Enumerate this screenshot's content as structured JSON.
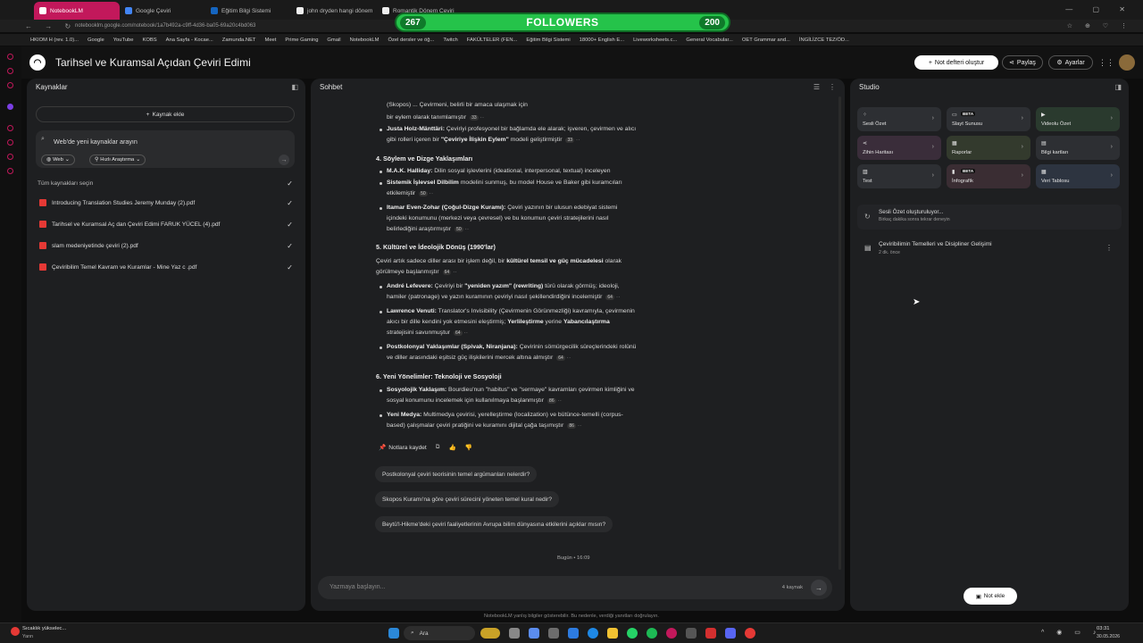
{
  "browser": {
    "tabs": [
      {
        "label": "NotebookLM",
        "active": true
      },
      {
        "label": "Google Çeviri",
        "active": false
      },
      {
        "label": "Eğitim Bilgi Sistemi",
        "active": false
      },
      {
        "label": "john dryden hangi dönem",
        "active": false
      },
      {
        "label": "Romantik Dönem Çeviri",
        "active": false
      }
    ],
    "url": "notebooklm.google.com/notebook/1a7b492a-c9ff-4d36-ba05-69a20c4bd063",
    "bookmarks": [
      "HKIOM H (rev. 1.0)...",
      "Google",
      "YouTube",
      "KOBS",
      "Ana Sayfa - Kocae...",
      "Zamunda.NET",
      "Meet",
      "Prime Gaming",
      "Gmail",
      "NotebookLM",
      "Özel dersler ve öğ...",
      "Twitch",
      "FAKÜLTELER (FEN...",
      "Eğitim Bilgi Sistemi",
      "18000+ English E...",
      "Liveworksheets.c...",
      "General Vocabular...",
      "OET Grammar and...",
      "İNGİLİZCE TEZ/ÖD..."
    ]
  },
  "overlay": {
    "left_count": "267",
    "label": "FOLLOWERS",
    "right_count": "200"
  },
  "header": {
    "title": "Tarihsel ve Kuramsal Açıdan Çeviri Edimi",
    "new_notebook": "Not defteri oluştur",
    "share": "Paylaş",
    "settings": "Ayarlar"
  },
  "sources": {
    "title": "Kaynaklar",
    "add_source": "Kaynak ekle",
    "search_placeholder": "Web'de yeni kaynaklar arayın",
    "web_chip": "Web",
    "research_chip": "Hızlı Araştırma",
    "select_all": "Tüm kaynakları seçin",
    "items": [
      "Introducing Translation Studies Jeremy Munday (2).pdf",
      "Tarihsel ve Kuramsal Aç dan Çeviri Edimi FARUK YÜCEL (4).pdf",
      "slam medeniyetinde çeviri (2).pdf",
      "Çeviribilim Temel Kavram ve Kuramlar - Mine Yaz c .pdf"
    ]
  },
  "chat": {
    "title": "Sohbet",
    "lines": [
      {
        "t": "(Skopos) ... Çevirmeni, belirli bir amaca ulaşmak için",
        "bold": false
      },
      {
        "t": "bir eylem olarak tanımlamıştır",
        "cite": "33"
      },
      {
        "b": "Justa Holz-Mänttäri:",
        "t": " Çeviriyi profesyonel bir bağlamda ele alarak; işveren, çevirmen ve alıcı"
      },
      {
        "t": "gibi rolleri içeren bir ",
        "b2": "\"Çeviriye İlişkin Eylem\"",
        "t2": " modeli geliştirmiştir",
        "cite": "33"
      },
      {
        "h": "4. Söylem ve Dizge Yaklaşımları"
      },
      {
        "b": "M.A.K. Halliday:",
        "t": " Dilin sosyal işlevlerini (ideational, interpersonal, textual) inceleyen"
      },
      {
        "b": "Sistemik İşlevsel Dilbilim",
        "t": " modelini sunmuş, bu model House ve Baker gibi kuramcıları"
      },
      {
        "t": "etkilemiştir",
        "cite": "50"
      },
      {
        "b": "Itamar Even-Zohar (Çoğul-Dizge Kuramı):",
        "t": " Çeviri yazının bir ulusun edebiyat sistemi"
      },
      {
        "t": "içindeki konumunu (merkezi veya çevresel) ve bu konumun çeviri stratejilerini nasıl"
      },
      {
        "t": "belirlediğini araştırmıştır",
        "cite": "50"
      },
      {
        "h": "5. Kültürel ve İdeolojik Dönüş (1990'lar)"
      },
      {
        "t": "Çeviri artık sadece diller arası bir işlem değil, bir ",
        "b2": "kültürel temsil ve güç mücadelesi",
        "t2": " olarak"
      },
      {
        "t": "görülmeye başlanmıştır",
        "cite": "64"
      },
      {
        "b": "André Lefevere:",
        "t": " Çeviriyi bir ",
        "b2": "\"yeniden yazım\" (rewriting)",
        "t2": " türü olarak görmüş; ideoloji,"
      },
      {
        "t": "hamiler (patronage) ve yazın kuramının çeviriyi nasıl şekillendirdiğini incelemiştir",
        "cite": "64"
      },
      {
        "b": "Lawrence Venuti:",
        "t": " Translator's Invisibility (Çevirmenin Görünmezliği) kavramıyla, çevirmenin"
      },
      {
        "t": "akıcı bir dille kendini yok etmesini eleştirmiş; ",
        "b2": "Yerlileştirme",
        "t2": " yerine ",
        "b3": "Yabancılaştırma"
      },
      {
        "t": "stratejisini savunmuştur",
        "cite": "64"
      },
      {
        "b": "Postkolonyal Yaklaşımlar (Spivak, Niranjana):",
        "t": " Çevirinin sömürgecilik süreçlerindeki rolünü"
      },
      {
        "t": "ve diller arasındaki eşitsiz güç ilişkilerini mercek altına almıştır",
        "cite": "64"
      },
      {
        "h": "6. Yeni Yönelimler: Teknoloji ve Sosyoloji"
      },
      {
        "b": "Sosyolojik Yaklaşım:",
        "t": " Bourdieu'nun \"habitus\" ve \"sermaye\" kavramları çevirmen kimliğini ve"
      },
      {
        "t": "sosyal konumunu incelemek için kullanılmaya başlanmıştır",
        "cite": "86"
      },
      {
        "b": "Yeni Medya:",
        "t": " Multimedya çevirisi, yerelleştirme (localization) ve bütünce-temelli (corpus-"
      },
      {
        "t": "based) çalışmalar çeviri pratiğini ve kuramını dijital çağa taşımıştır",
        "cite": "86"
      }
    ],
    "save_to_notes": "Notlara kaydet",
    "suggestions": [
      "Postkolonyal çeviri teorisinin temel argümanları nelerdir?",
      "Skopos Kuramı'na göre çeviri sürecini yöneten temel kural nedir?",
      "Beytü'l-Hikme'deki çeviri faaliyetlerinin Avrupa bilim dünyasına etkilerini açıklar mısın?"
    ],
    "timestamp": "Bugün • 16:09",
    "input_placeholder": "Yazmaya başlayın...",
    "source_count": "4 kaynak"
  },
  "studio": {
    "title": "Studio",
    "tiles": [
      {
        "label": "Sesli Özet",
        "icon": "audio-icon",
        "beta": false
      },
      {
        "label": "Slayt Sunusu",
        "icon": "slides-icon",
        "beta": true
      },
      {
        "label": "Videolu Özet",
        "icon": "video-icon",
        "beta": false
      },
      {
        "label": "Zihin Haritası",
        "icon": "mindmap-icon",
        "beta": false
      },
      {
        "label": "Raporlar",
        "icon": "report-icon",
        "beta": false
      },
      {
        "label": "Bilgi kartları",
        "icon": "flashcard-icon",
        "beta": false
      },
      {
        "label": "Test",
        "icon": "quiz-icon",
        "beta": false
      },
      {
        "label": "İnfografik",
        "icon": "infographic-icon",
        "beta": true
      },
      {
        "label": "Veri Tablosu",
        "icon": "table-icon",
        "beta": false
      }
    ],
    "beta_label": "BETA",
    "generating_title": "Sesli Özet oluşturuluyor...",
    "generating_sub": "Birkaç dakika sonra tekrar deneyin",
    "note_title": "Çeviribilimin Temelleri ve Disipliner Gelişimi",
    "note_sub": "2 dk. önce",
    "add_note": "Not ekle"
  },
  "footer_notice": "NotebookLM yanlış bilgiler gösterebilir. Bu nedenle, verdiği yanıtları doğrulayın.",
  "taskbar": {
    "weather": "Sıcaklık yükselec...",
    "weather_sub": "Yarın",
    "search": "Ara",
    "time": "03:31",
    "date": "30.05.2026"
  }
}
